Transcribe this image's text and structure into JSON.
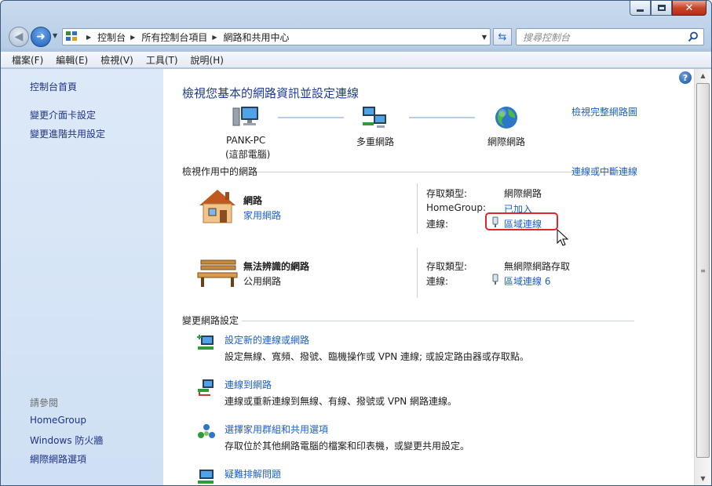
{
  "window": {
    "minimize_label": "minimize",
    "maximize_label": "maximize",
    "close_label": "close"
  },
  "address": {
    "crumbs": [
      "控制台",
      "所有控制台項目",
      "網路和共用中心"
    ],
    "search_placeholder": "搜尋控制台"
  },
  "menu": [
    "檔案(F)",
    "編輯(E)",
    "檢視(V)",
    "工具(T)",
    "說明(H)"
  ],
  "sidebar": {
    "home": "控制台首頁",
    "links": [
      "變更介面卡設定",
      "變更進階共用設定"
    ],
    "see_also_title": "請參閱",
    "see_also": [
      "HomeGroup",
      "Windows 防火牆",
      "網際網路選項"
    ]
  },
  "main": {
    "title": "檢視您基本的網路資訊並設定連線",
    "view_full_map": "檢視完整網路圖",
    "map": [
      {
        "label": "PANK-PC",
        "sublabel": "(這部電腦)"
      },
      {
        "label": "多重網路"
      },
      {
        "label": "網際網路"
      }
    ],
    "active_section": "檢視作用中的網路",
    "connect_disconnect": "連線或中斷連線",
    "networks": [
      {
        "name": "網路",
        "type": "家用網路",
        "access_type_label": "存取類型:",
        "access_type_value": "網際網路",
        "homegroup_label": "HomeGroup:",
        "homegroup_value": "已加入",
        "connection_label": "連線:",
        "connection_value": "區域連線"
      },
      {
        "name": "無法辨識的網路",
        "type": "公用網路",
        "access_type_label": "存取類型:",
        "access_type_value": "無網際網路存取",
        "connection_label": "連線:",
        "connection_value": "區域連線 6"
      }
    ],
    "change_section": "變更網路設定",
    "tasks": [
      {
        "title": "設定新的連線或網路",
        "desc": "設定無線、寬頻、撥號、臨機操作或 VPN 連線; 或設定路由器或存取點。"
      },
      {
        "title": "連線到網路",
        "desc": "連線或重新連線到無線、有線、撥號或 VPN 網路連線。"
      },
      {
        "title": "選擇家用群組和共用選項",
        "desc": "存取位於其他網路電腦的檔案和印表機，或變更共用設定。"
      },
      {
        "title": "疑難排解問題",
        "desc": ""
      }
    ]
  },
  "colors": {
    "link": "#1d5fc4",
    "title": "#1e3c8f",
    "highlight": "#e0262b",
    "sidebar_bg": "#d6e5f6"
  }
}
